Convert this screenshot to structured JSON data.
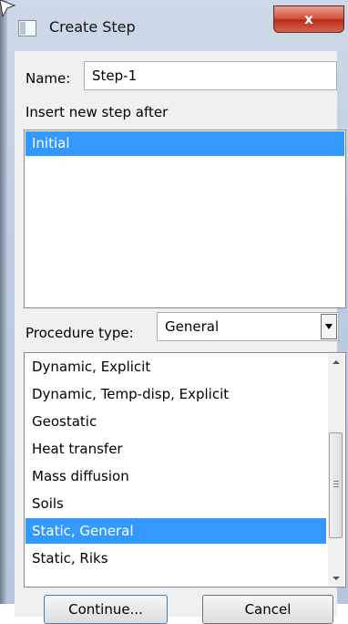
{
  "window": {
    "title": "Create Step",
    "close_label": "x"
  },
  "name": {
    "label": "Name:",
    "value": "Step-1"
  },
  "insert": {
    "label": "Insert new step after",
    "items": [
      "Initial"
    ],
    "selected": "Initial"
  },
  "procedure": {
    "label": "Procedure type:",
    "value": "General",
    "items": [
      "Dynamic, Explicit",
      "Dynamic, Temp-disp, Explicit",
      "Geostatic",
      "Heat transfer",
      "Mass diffusion",
      "Soils",
      "Static, General",
      "Static, Riks"
    ],
    "selected": "Static, General"
  },
  "buttons": {
    "continue_label": "Continue...",
    "cancel_label": "Cancel"
  },
  "colors": {
    "selection": "#3399ff",
    "close_button": "#c9412c"
  }
}
